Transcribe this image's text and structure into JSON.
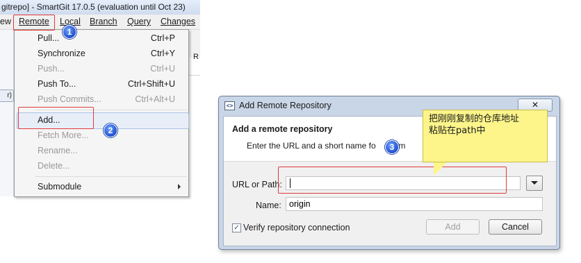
{
  "window": {
    "title": "gitrepo] - SmartGit 17.0.5 (evaluation until Oct 23)"
  },
  "menubar": {
    "items": [
      {
        "label": "ew"
      },
      {
        "label": "Remote"
      },
      {
        "label": "Local"
      },
      {
        "label": "Branch"
      },
      {
        "label": "Query"
      },
      {
        "label": "Changes"
      }
    ]
  },
  "side": {
    "left_tag": "r)",
    "right_letter": "R"
  },
  "remote_menu": {
    "items": [
      {
        "label": "Pull...",
        "shortcut": "Ctrl+P",
        "enabled": true
      },
      {
        "label": "Synchronize",
        "shortcut": "Ctrl+Y",
        "enabled": true
      },
      {
        "label": "Push...",
        "shortcut": "Ctrl+U",
        "enabled": false
      },
      {
        "label": "Push To...",
        "shortcut": "Ctrl+Shift+U",
        "enabled": true
      },
      {
        "label": "Push Commits...",
        "shortcut": "Ctrl+Alt+U",
        "enabled": false
      },
      {
        "label": "Add...",
        "shortcut": "",
        "enabled": true
      },
      {
        "label": "Fetch More...",
        "shortcut": "",
        "enabled": false
      },
      {
        "label": "Rename...",
        "shortcut": "",
        "enabled": false
      },
      {
        "label": "Delete...",
        "shortcut": "",
        "enabled": false
      },
      {
        "label": "Submodule",
        "shortcut": "",
        "enabled": true
      }
    ]
  },
  "badges": {
    "one": "1",
    "two": "2",
    "three": "3"
  },
  "dialog": {
    "title": "Add Remote Repository",
    "close_glyph": "✕",
    "icon_glyph": "<>",
    "heading": "Add a remote repository",
    "subtitle": "Enter the URL and a short name fo",
    "subtitle_tail": "rem",
    "url_label": "URL or Path:",
    "url_value": "",
    "name_label": "Name:",
    "name_value": "origin",
    "verify_label": "Verify repository connection",
    "verify_checked": true,
    "add_label": "Add",
    "cancel_label": "Cancel"
  },
  "callout": {
    "line1": "把刚刚复制的仓库地址",
    "line2": "粘贴在path中"
  },
  "colors": {
    "annotation_red": "#e23a3a",
    "badge_blue": "#1f4fcf",
    "callout_yellow": "#fdf58a"
  }
}
